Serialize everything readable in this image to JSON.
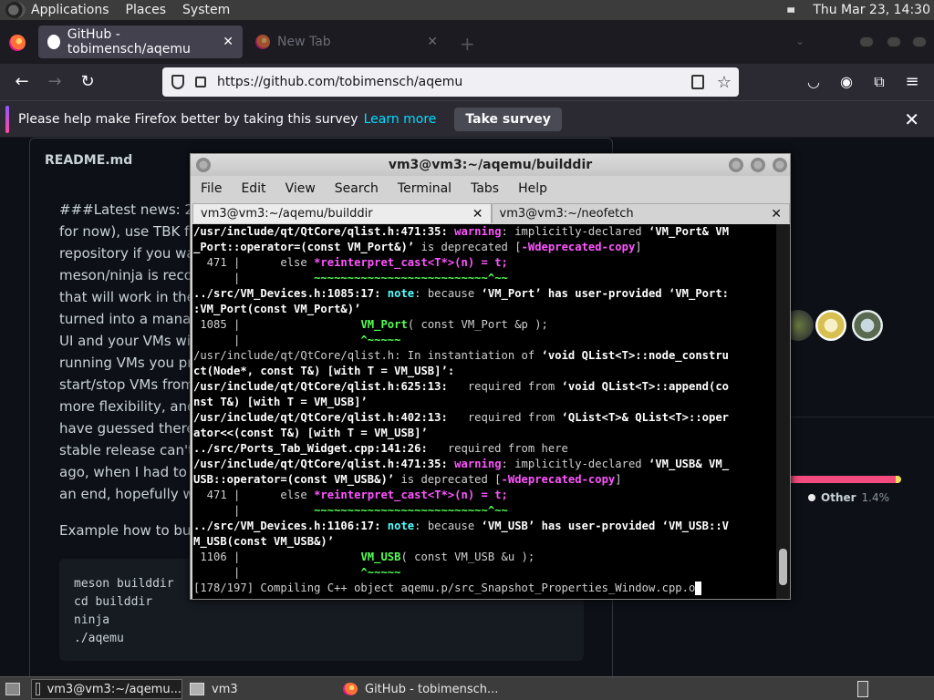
{
  "system_panel": {
    "menus": [
      "Applications",
      "Places",
      "System"
    ],
    "clock": "Thu Mar 23, 14:30"
  },
  "browser": {
    "tabs": [
      {
        "label": "GitHub - tobimensch/aqemu"
      },
      {
        "label": "New Tab"
      }
    ],
    "url": "https://github.com/tobimensch/aqemu",
    "survey": {
      "text": "Please help make Firefox better by taking this survey",
      "link": "Learn more",
      "button": "Take survey"
    }
  },
  "readme": {
    "header": "README.md",
    "lines": [
      "###Latest news: 202",
      "for now), use TBK fo",
      "repository if you wan",
      "meson/ninja is recom",
      "that will work in the n",
      "turned into a manag",
      "UI and your VMs wil",
      "running VMs you pre",
      "start/stop VMs from",
      "more flexibility, and h",
      "have guessed there",
      "stable release can't",
      "ago, when I had to s",
      "an end, hopefully wit"
    ],
    "example": "Example how to buil",
    "code": [
      "meson builddir",
      "cd builddir",
      "ninja",
      "./aqemu"
    ]
  },
  "sidebar": {
    "other_lang_label": "Other",
    "other_lang_pct": "1.4%",
    "main_lang_fraction": 0.952
  },
  "terminal": {
    "title": "vm3@vm3:~/aqemu/builddir",
    "menus": [
      "File",
      "Edit",
      "View",
      "Search",
      "Terminal",
      "Tabs",
      "Help"
    ],
    "tabs": [
      "vm3@vm3:~/aqemu/builddir",
      "vm3@vm3:~/neofetch"
    ],
    "lines": [
      {
        "a": "/usr/include/qt/QtCore/qlist.h:471:35: ",
        "w": "warning",
        "c": ": implicitly-declared ",
        "d": "‘VM_Port& VM"
      },
      {
        "a": "_Port::operator=(const VM_Port&)’",
        "c": " is deprecated [",
        "m": "-Wdeprecated-copy",
        "e": "]"
      },
      {
        "p": "  471 |      else ",
        "x": "*reinterpret_cast<T*>(n) = t;"
      },
      {
        "p": "      |           ",
        "g": "~~~~~~~~~~~~~~~~~~~~~~~~~~^~~"
      },
      {
        "a": "../src/VM_Devices.h:1085:17: ",
        "n": "note",
        "c": ": because ",
        "d": "‘VM_Port’ has user-provided ‘VM_Port:"
      },
      {
        "a": ":VM_Port(const VM_Port&)’"
      },
      {
        "p": " 1085 |                  ",
        "k": "VM_Port",
        "z": "( const VM_Port &p );"
      },
      {
        "p": "      |                  ",
        "g": "^~~~~~"
      },
      {
        "c": "/usr/include/qt/QtCore/qlist.h: In instantiation of ",
        "d": "‘void QList<T>::node_constru"
      },
      {
        "a": "ct(Node*, const T&) [with T = VM_USB]’:"
      },
      {
        "a": "/usr/include/qt/QtCore/qlist.h:625:13:",
        "c": "   required from ",
        "d": "‘void QList<T>::append(co"
      },
      {
        "a": "nst T&) [with T = VM_USB]’"
      },
      {
        "a": "/usr/include/qt/QtCore/qlist.h:402:13:",
        "c": "   required from ",
        "d": "‘QList<T>& QList<T>::oper"
      },
      {
        "a": "ator<<(const T&) [with T = VM_USB]’"
      },
      {
        "a": "../src/Ports_Tab_Widget.cpp:141:26:",
        "c": "   required from here"
      },
      {
        "a": "/usr/include/qt/QtCore/qlist.h:471:35: ",
        "w": "warning",
        "c": ": implicitly-declared ",
        "d": "‘VM_USB& VM_"
      },
      {
        "a": "USB::operator=(const VM_USB&)’",
        "c": " is deprecated [",
        "m": "-Wdeprecated-copy",
        "e": "]"
      },
      {
        "p": "  471 |      else ",
        "x": "*reinterpret_cast<T*>(n) = t;"
      },
      {
        "p": "      |           ",
        "g": "~~~~~~~~~~~~~~~~~~~~~~~~~~^~~"
      },
      {
        "a": "../src/VM_Devices.h:1106:17: ",
        "n": "note",
        "c": ": because ",
        "d": "‘VM_USB’ has user-provided ‘VM_USB::V"
      },
      {
        "a": "M_USB(const VM_USB&)’"
      },
      {
        "p": " 1106 |                  ",
        "k": "VM_USB",
        "z": "( const VM_USB &u );"
      },
      {
        "p": "      |                  ",
        "g": "^~~~~~"
      },
      {
        "c": "[178/197] Compiling C++ object aqemu.p/src_Snapshot_Properties_Window.cpp.o"
      }
    ]
  },
  "taskbar": {
    "items": [
      "vm3@vm3:~/aqemu...",
      "vm3",
      "GitHub - tobimensch..."
    ]
  }
}
